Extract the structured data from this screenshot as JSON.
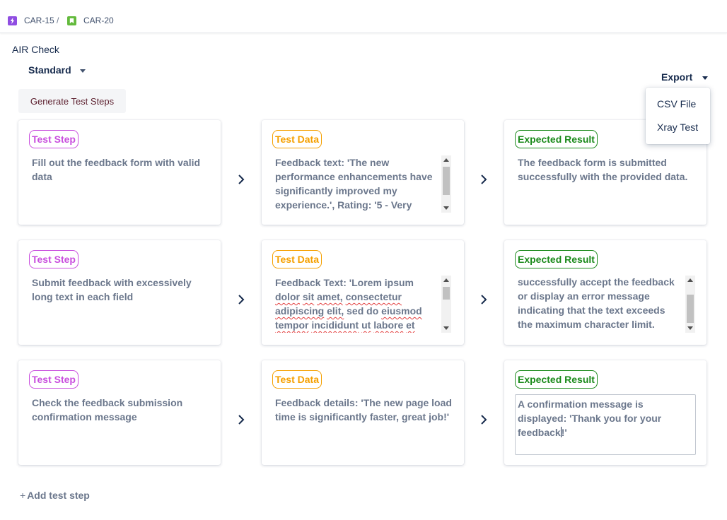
{
  "breadcrumb": {
    "parent": {
      "key": "CAR-15",
      "icon": "epic-lightning-icon"
    },
    "separator": "/",
    "current": {
      "key": "CAR-20",
      "icon": "story-bookmark-icon"
    }
  },
  "app": {
    "title": "AIR Check",
    "mode": {
      "selected": "Standard"
    },
    "generate_label": "Generate Test Steps"
  },
  "export": {
    "label": "Export",
    "menu": [
      "CSV File",
      "Xray Test"
    ]
  },
  "labels": {
    "step": "Test Step",
    "data": "Test Data",
    "result": "Expected Result"
  },
  "rows": [
    {
      "step": "Fill out the feedback form with valid data",
      "data": "Feedback text: 'The new performance enhancements have significantly improved my experience.', Rating: '5 - Very",
      "result": "The feedback form is submitted successfully with the provided data."
    },
    {
      "step": "Submit feedback with excessively long text in each field",
      "data_plain": "Feedback Text: 'Lorem ipsum ",
      "data_words": [
        "dolor",
        "sit",
        "amet,",
        "consectetur",
        "adipiscing",
        "elit,",
        "sed",
        "do",
        "eiusmod",
        "tempor",
        "incididunt",
        "ut",
        "labore",
        "et"
      ],
      "result": "successfully accept the feedback or display an error message indicating that the text exceeds the maximum character limit."
    },
    {
      "step": "Check the feedback submission confirmation message",
      "data": "Feedback details: 'The new page load time is significantly faster, great job!'",
      "result_before_cursor": "A confirmation message is displayed: 'Thank you for your feedback",
      "result_after_cursor": "!'"
    }
  ],
  "add_step_label": "Add test step",
  "colors": {
    "step": "#c94fde",
    "data": "#f5a000",
    "result": "#1b8a1b",
    "epic": "#904ee2",
    "story": "#63ba3c"
  }
}
